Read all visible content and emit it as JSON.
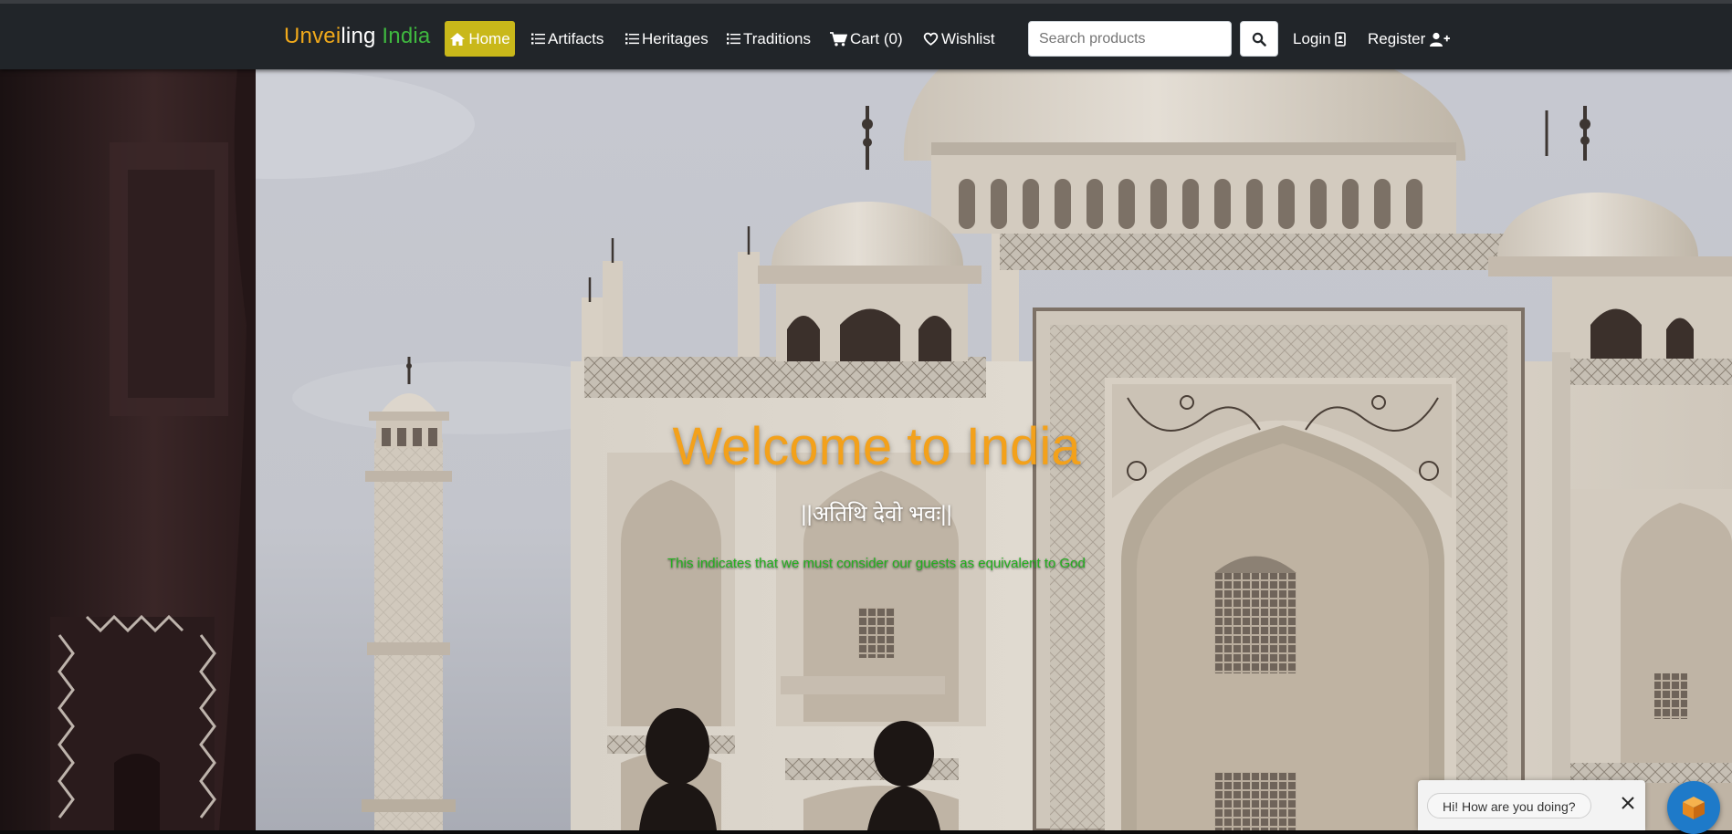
{
  "navbar": {
    "brand": {
      "part1": "Un",
      "part2": "vei",
      "part3": "ling ",
      "part4": "India"
    },
    "items": [
      {
        "label": "Home",
        "icon": "home-icon",
        "active": true
      },
      {
        "label": "Artifacts",
        "icon": "list-icon"
      },
      {
        "label": "Heritages",
        "icon": "list-icon"
      },
      {
        "label": "Traditions",
        "icon": "list-icon"
      },
      {
        "label": "Cart (0)",
        "icon": "cart-icon"
      },
      {
        "label": "Wishlist",
        "icon": "heart-icon"
      }
    ],
    "search": {
      "placeholder": "Search products",
      "value": ""
    },
    "login_label": "Login",
    "register_label": "Register"
  },
  "hero": {
    "title": "Welcome to India",
    "subtitle": "||अतिथि देवो भवः||",
    "description": "This indicates that we must consider our guests as equivalent to God",
    "background": "taj-mahal-photo"
  },
  "chat": {
    "message": "Hi! How are you doing?",
    "close_icon": "close-icon",
    "launcher_icon": "chat-cube-icon"
  },
  "colors": {
    "navbar_bg": "#212529",
    "active_nav_bg": "#c9b81a",
    "brand_orange": "#f0a91b",
    "brand_green": "#3fb83f",
    "title_orange": "#f3a11b",
    "description_green": "#23b01f",
    "chat_launcher_blue": "#1e7ac9"
  }
}
